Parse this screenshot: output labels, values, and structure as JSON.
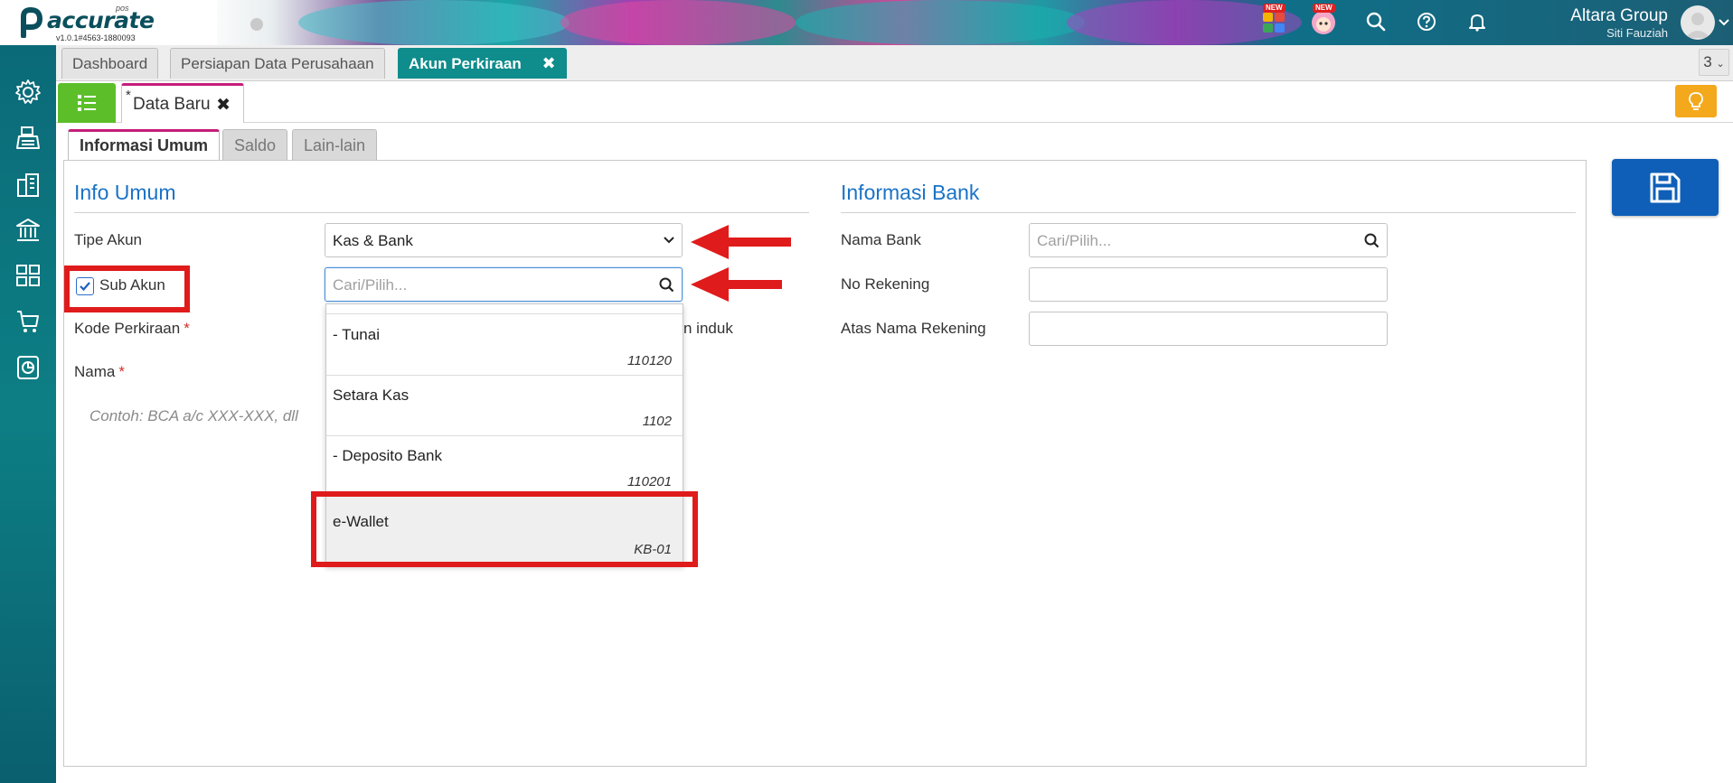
{
  "app": {
    "logo_text": "accurate",
    "logo_sub": "pos",
    "version": "v1.0.1#4563-1880093",
    "new_badge": "NEW",
    "company_name": "Altara Group",
    "user_name": "Siti Fauziah"
  },
  "module_tabs": [
    {
      "label": "Dashboard"
    },
    {
      "label": "Persiapan Data Perusahaan"
    },
    {
      "label": "Akun Perkiraan"
    }
  ],
  "tab_count": "3",
  "document_tab": {
    "modified_marker": "*",
    "title": "Data Baru"
  },
  "form_tabs": [
    {
      "label": "Informasi Umum"
    },
    {
      "label": "Saldo"
    },
    {
      "label": "Lain-lain"
    }
  ],
  "info_umum": {
    "title": "Info Umum",
    "tipe_akun_label": "Tipe Akun",
    "tipe_akun_value": "Kas & Bank",
    "sub_akun_label": "Sub Akun",
    "sub_akun_checked": true,
    "parent_search_placeholder": "Cari/Pilih...",
    "kode_label": "Kode Perkiraan",
    "nama_label": "Nama",
    "nama_placeholder": "Contoh: BCA a/c XXX-XXX, dll",
    "partial_text": "n induk",
    "required_mark": "*"
  },
  "info_bank": {
    "title": "Informasi Bank",
    "nama_bank_label": "Nama Bank",
    "nama_bank_placeholder": "Cari/Pilih...",
    "no_rekening_label": "No Rekening",
    "no_rekening_value": "",
    "atas_nama_label": "Atas Nama Rekening",
    "atas_nama_value": ""
  },
  "dropdown_items": [
    {
      "name": "- Tunai",
      "code": "110120"
    },
    {
      "name": "Setara Kas",
      "code": "1102"
    },
    {
      "name": "- Deposito Bank",
      "code": "110201"
    },
    {
      "name": "e-Wallet",
      "code": "KB-01"
    }
  ],
  "colors": {
    "accent_teal": "#0f8c8c",
    "highlight_red": "#e01b1b",
    "title_blue": "#1a73c7",
    "save_blue": "#0f5fb8",
    "list_green": "#5cbf2a",
    "bulb_orange": "#f4a81c"
  },
  "sidebar_icons": [
    "settings-icon",
    "cash-register-icon",
    "building-icon",
    "bank-icon",
    "inventory-icon",
    "cart-icon",
    "report-icon"
  ]
}
